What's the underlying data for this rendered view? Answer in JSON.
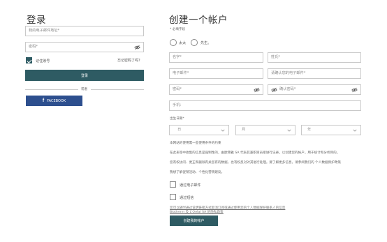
{
  "login": {
    "title": "登录",
    "email_placeholder": "我的电子邮件地址*",
    "password_placeholder": "密码*",
    "remember_label": "记住账号",
    "forgot_link": "忘记密码了吗？",
    "login_button": "登录",
    "or_label": "或者",
    "facebook_button": "FACEBOOK"
  },
  "register": {
    "title": "创建一个帐户",
    "required_note": "* 必填字段",
    "salutation_options": [
      "太太",
      "先生。"
    ],
    "first_name_placeholder": "名字*",
    "last_name_placeholder": "姓氏*",
    "email_placeholder": "电子邮件*",
    "confirm_email_placeholder": "请确认您的电子邮件*",
    "password_placeholder": "密码*",
    "confirm_password_placeholder": "确认密码*",
    "phone_placeholder": "手机：",
    "birthdate_label": "出生日期*",
    "day_select": "日",
    "month_select": "月",
    "year_select": "年",
    "marketing_title": "本网站的使用需一些使用条件的约束",
    "marketing_lines": [
      "在此表等中收集的信息是强制性的，由欧莱雅 SA 代表其兼职资员接进行记录，以创建您的帐户，用于统计和分析目的。",
      "您有权访问、更正和删除有关您有的数据，也有权反对对其进行处理。要了解更多信息，请参阅我们的 个人数据保护政策",
      "我想了解促销活动、个性化营销建议。"
    ],
    "opt_email_label": "通过电子邮件",
    "opt_sms_label": "通过短信",
    "footer_notice": "您可以随时通过说明链接方式取消订阅或通过使用您的个人数据保护联系人的信息",
    "footer_notice2": "Biotherm 及 L'Oréal SA 的隐私政策",
    "create_button": "创建我的帐户"
  },
  "icons": {
    "eye": "eye-slash-icon",
    "facebook": "facebook-icon",
    "chevron": "chevron-down-icon"
  },
  "colors": {
    "primary": "#2e5b63",
    "facebook": "#2d4f8e"
  }
}
